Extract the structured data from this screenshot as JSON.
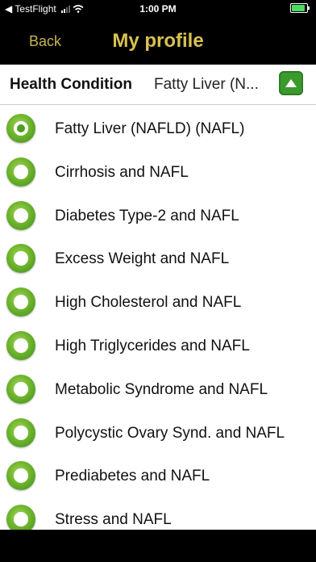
{
  "status": {
    "carrier": "◀ TestFlight",
    "time": "1:00 PM"
  },
  "nav": {
    "back_label": "Back",
    "title": "My profile"
  },
  "header": {
    "label": "Health Condition",
    "value": "Fatty Liver (N..."
  },
  "conditions": [
    "Fatty Liver (NAFLD) (NAFL)",
    "Cirrhosis and NAFL",
    "Diabetes Type-2 and NAFL",
    "Excess Weight and NAFL",
    "High Cholesterol and NAFL",
    "High Triglycerides and NAFL",
    "Metabolic Syndrome and NAFL",
    "Polycystic Ovary Synd. and NAFL",
    "Prediabetes and NAFL",
    "Stress and NAFL"
  ],
  "selected_index": 0,
  "colors": {
    "accent": "#d8c24f",
    "radio_green": "#6fb52d",
    "button_green": "#3a9a2e"
  }
}
